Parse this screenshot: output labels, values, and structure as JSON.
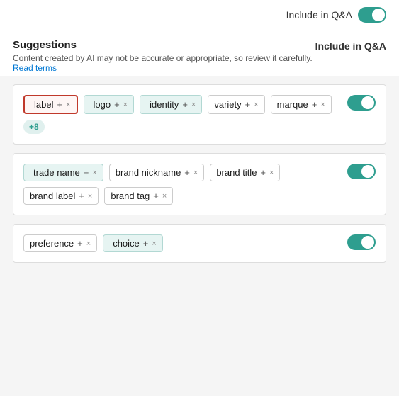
{
  "topbar": {
    "toggle_label": "Include in Q&A",
    "toggle_on": true
  },
  "suggestions": {
    "heading": "Suggestions",
    "description": "Content created by AI may not be accurate or appropriate, so review it carefully.",
    "read_terms": "Read terms",
    "column_header": "Include in Q&A"
  },
  "cards": [
    {
      "id": "card1",
      "toggle_on": true,
      "tags": [
        {
          "type": "ai",
          "text": "label",
          "highlighted": true
        },
        {
          "type": "ai",
          "text": "logo"
        },
        {
          "type": "ai",
          "text": "identity"
        },
        {
          "type": "plain",
          "text": "variety"
        },
        {
          "type": "plain",
          "text": "marque"
        },
        {
          "type": "more",
          "text": "+8"
        }
      ]
    },
    {
      "id": "card2",
      "toggle_on": true,
      "tags": [
        {
          "type": "ai",
          "text": "trade name"
        },
        {
          "type": "plain",
          "text": "brand nickname"
        },
        {
          "type": "plain",
          "text": "brand title"
        },
        {
          "type": "plain",
          "text": "brand label"
        },
        {
          "type": "plain",
          "text": "brand tag"
        }
      ]
    },
    {
      "id": "card3",
      "toggle_on": true,
      "tags": [
        {
          "type": "plain",
          "text": "preference"
        },
        {
          "type": "ai",
          "text": "choice"
        }
      ]
    }
  ],
  "icons": {
    "diamond": "◈",
    "plus": "+",
    "close": "×"
  }
}
